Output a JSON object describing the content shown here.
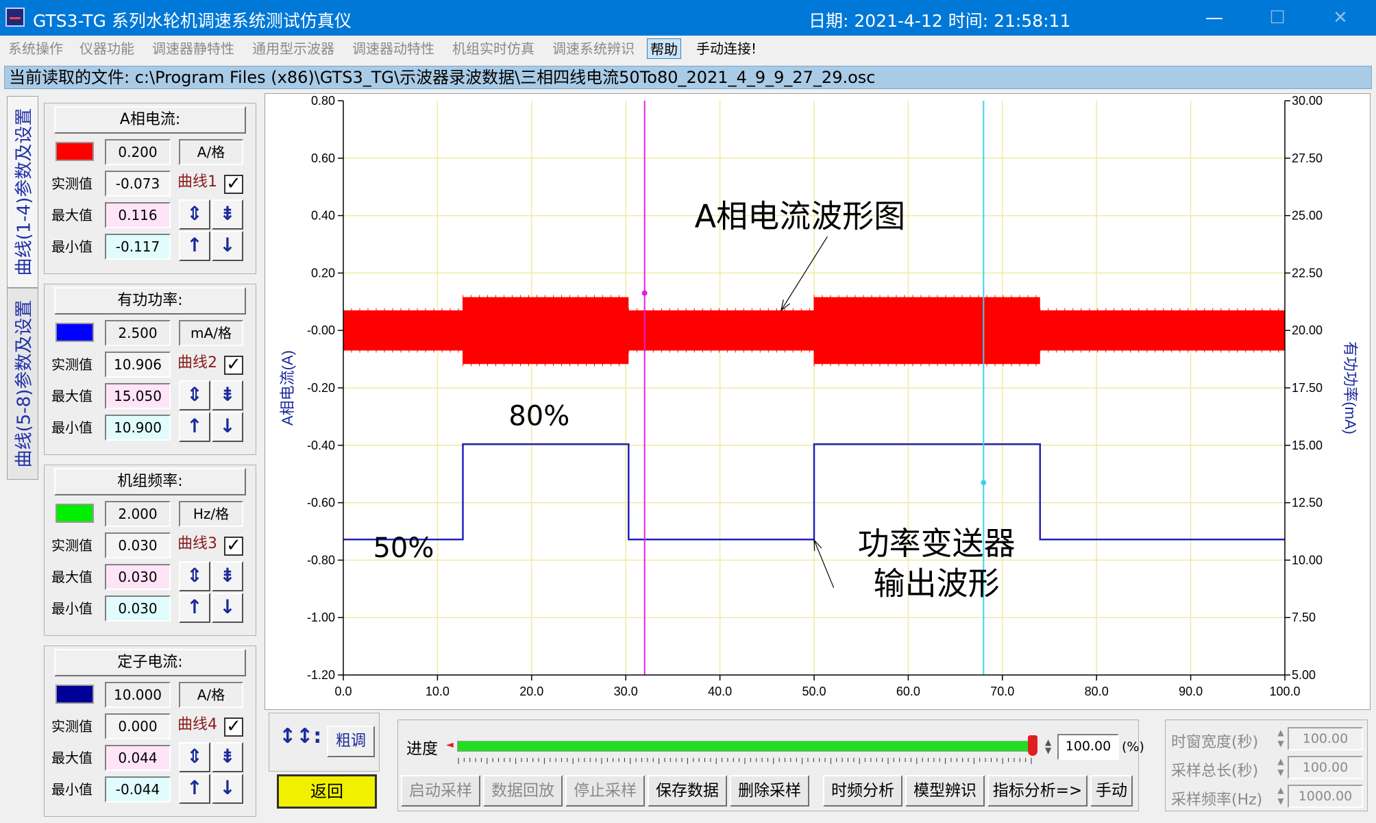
{
  "window": {
    "title": "GTS3-TG 系列水轮机调速系统测试仿真仪",
    "datetime": "日期: 2021-4-12 时间: 21:58:11",
    "min_glyph": "—",
    "max_glyph": "☐",
    "close_glyph": "✕"
  },
  "menu": [
    {
      "label": "系统操作",
      "state": "disabled"
    },
    {
      "label": "仪器功能",
      "state": "disabled"
    },
    {
      "label": "调速器静特性",
      "state": "disabled"
    },
    {
      "label": "通用型示波器",
      "state": "disabled"
    },
    {
      "label": "调速器动特性",
      "state": "disabled"
    },
    {
      "label": "机组实时仿真",
      "state": "disabled"
    },
    {
      "label": "调速系统辨识",
      "state": "disabled"
    },
    {
      "label": "帮助",
      "state": "active"
    },
    {
      "label": "手动连接!",
      "state": "enabled"
    }
  ],
  "file_bar": "当前读取的文件: c:\\Program Files (x86)\\GTS3_TG\\示波器录波数据\\三相四线电流50To80_2021_4_9_9_27_29.osc",
  "tabs": [
    "曲线(1-4)参数及设置",
    "曲线(5-8)参数及设置"
  ],
  "labels": {
    "measured": "实测值",
    "max": "最大值",
    "min": "最小值"
  },
  "checkmark": "✓",
  "arrow_icons": {
    "expand": "⇕",
    "compress": "⇟",
    "up": "↑",
    "down": "↓"
  },
  "curves": [
    {
      "title": "A相电流:",
      "color": "#ff0000",
      "scale": "0.200",
      "unit": "A/格",
      "measured": "-0.073",
      "curve": "曲线1",
      "max": "0.116",
      "min": "-0.117"
    },
    {
      "title": "有功功率:",
      "color": "#0000ff",
      "scale": "2.500",
      "unit": "mA/格",
      "measured": "10.906",
      "curve": "曲线2",
      "max": "15.050",
      "min": "10.900"
    },
    {
      "title": "机组频率:",
      "color": "#00ee00",
      "scale": "2.000",
      "unit": "Hz/格",
      "measured": "0.030",
      "curve": "曲线3",
      "max": "0.030",
      "min": "0.030"
    },
    {
      "title": "定子电流:",
      "color": "#000099",
      "scale": "10.000",
      "unit": "A/格",
      "measured": "0.000",
      "curve": "曲线4",
      "max": "0.044",
      "min": "-0.044"
    }
  ],
  "chart_data": {
    "type": "line",
    "xlim": [
      0,
      100
    ],
    "x_ticks": [
      "0.0",
      "10.0",
      "20.0",
      "30.0",
      "40.0",
      "50.0",
      "60.0",
      "70.0",
      "80.0",
      "90.0",
      "100.0"
    ],
    "y_left": {
      "label": "A相电流(A)",
      "lim": [
        -1.2,
        0.8
      ],
      "ticks": [
        "0.80",
        "0.60",
        "0.40",
        "0.20",
        "-0.00",
        "-0.20",
        "-0.40",
        "-0.60",
        "-0.80",
        "-1.00",
        "-1.20"
      ]
    },
    "y_right": {
      "label": "有功功率(mA)",
      "lim": [
        5,
        30
      ],
      "ticks": [
        "30.00",
        "27.50",
        "25.00",
        "22.50",
        "20.00",
        "17.50",
        "15.00",
        "12.50",
        "10.00",
        "7.50",
        "5.00"
      ]
    },
    "grid": true,
    "series": [
      {
        "name": "A相电流",
        "axis": "left",
        "color": "#ff0000",
        "style": "envelope",
        "segments": [
          {
            "x0": 0,
            "x1": 12.7,
            "upper": 0.07,
            "lower": -0.07
          },
          {
            "x0": 12.7,
            "x1": 30.3,
            "upper": 0.116,
            "lower": -0.117
          },
          {
            "x0": 30.3,
            "x1": 50.0,
            "upper": 0.07,
            "lower": -0.07
          },
          {
            "x0": 50.0,
            "x1": 74.0,
            "upper": 0.116,
            "lower": -0.117
          },
          {
            "x0": 74.0,
            "x1": 100.0,
            "upper": 0.07,
            "lower": -0.07
          }
        ]
      },
      {
        "name": "有功功率",
        "axis": "right",
        "color": "#2020c0",
        "style": "step",
        "x": [
          0,
          12.7,
          12.7,
          30.3,
          30.3,
          50.0,
          50.0,
          74.0,
          74.0,
          100.0
        ],
        "y": [
          10.9,
          10.9,
          15.05,
          15.05,
          10.9,
          10.9,
          15.05,
          15.05,
          10.9,
          10.9
        ]
      }
    ],
    "cursors": [
      {
        "x": 32.0,
        "color": "#e020e0",
        "marker_y": 0.13
      },
      {
        "x": 68.0,
        "color": "#40d0f0",
        "marker_y": -0.53
      }
    ],
    "annotations": [
      {
        "text": "A相电流波形图",
        "x": 48.5,
        "y": 0.36,
        "arrow_to": [
          46.5,
          0.07
        ]
      },
      {
        "text": "80%",
        "x": 20.8,
        "y": -0.33
      },
      {
        "text": "50%",
        "x": 6.4,
        "y": -0.79
      },
      {
        "text": "功率变送器",
        "x": 63.0,
        "y": -0.78
      },
      {
        "text": "输出波形",
        "x": 63.0,
        "y": -0.92,
        "arrow_to": [
          50.0,
          -0.73
        ]
      }
    ]
  },
  "coarse_label": "粗调",
  "coarse_icon": "↕↕:",
  "back_button": "返回",
  "progress": {
    "label": "进度",
    "value": "100.00",
    "unit": "(%)",
    "fraction": 1.0
  },
  "buttons": [
    {
      "label": "启动采样",
      "enabled": false
    },
    {
      "label": "数据回放",
      "enabled": false
    },
    {
      "label": "停止采样",
      "enabled": false
    },
    {
      "label": "保存数据",
      "enabled": true
    },
    {
      "label": "删除采样",
      "enabled": true
    },
    {
      "label": "时频分析",
      "enabled": true
    },
    {
      "label": "模型辨识",
      "enabled": true
    },
    {
      "label": "指标分析=>",
      "enabled": true
    },
    {
      "label": "手动",
      "enabled": true
    }
  ],
  "sampling": [
    {
      "label": "时窗宽度(秒)",
      "value": "100.00"
    },
    {
      "label": "采样总长(秒)",
      "value": "100.00"
    },
    {
      "label": "采样频率(Hz)",
      "value": "1000.00"
    }
  ]
}
